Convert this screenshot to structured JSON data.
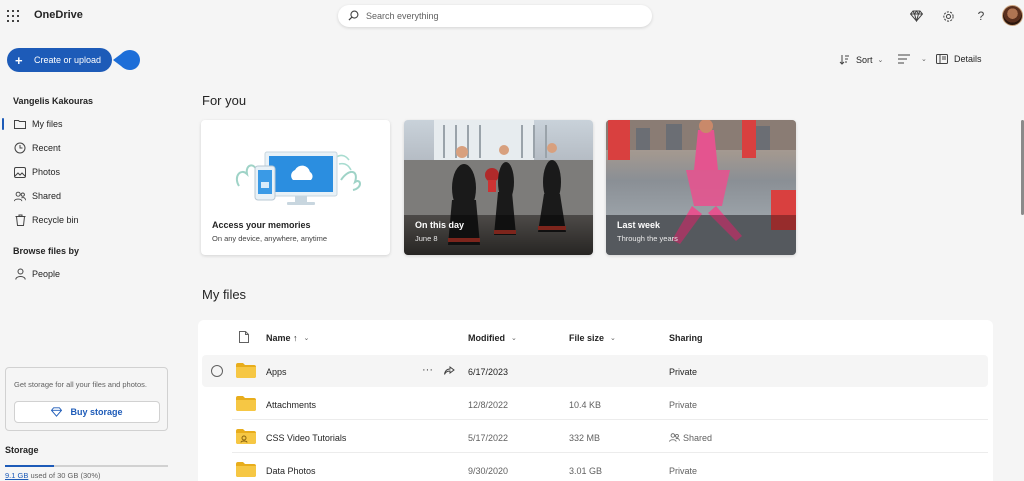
{
  "app": {
    "name": "OneDrive"
  },
  "search": {
    "placeholder": "Search everything"
  },
  "sidebar": {
    "create_label": "Create or upload",
    "user_name": "Vangelis Kakouras",
    "items": [
      {
        "label": "My files",
        "icon": "folder-icon",
        "active": true
      },
      {
        "label": "Recent",
        "icon": "clock-icon"
      },
      {
        "label": "Photos",
        "icon": "photo-icon"
      },
      {
        "label": "Shared",
        "icon": "people-icon"
      },
      {
        "label": "Recycle bin",
        "icon": "trash-icon"
      }
    ],
    "browse_title": "Browse files by",
    "browse_items": [
      {
        "label": "People",
        "icon": "person-icon"
      }
    ],
    "storage_promo": "Get storage for all your files and photos.",
    "buy_label": "Buy storage",
    "storage_title": "Storage",
    "storage_used_link": "9.1 GB",
    "storage_used_rest": " used of 30 GB (30%)",
    "storage_fraction": 0.3
  },
  "toolbar": {
    "sort_label": "Sort",
    "details_label": "Details"
  },
  "for_you": {
    "heading": "For you",
    "cards": [
      {
        "title": "Access your memories",
        "subtitle": "On any device, anywhere, anytime"
      },
      {
        "title": "On this day",
        "subtitle": "June 8"
      },
      {
        "title": "Last week",
        "subtitle": "Through the years"
      }
    ]
  },
  "my_files": {
    "heading": "My files",
    "columns": {
      "name": "Name ↑",
      "modified": "Modified",
      "size": "File size",
      "sharing": "Sharing"
    },
    "rows": [
      {
        "name": "Apps",
        "modified": "6/17/2023",
        "size": "",
        "sharing": "Private"
      },
      {
        "name": "Attachments",
        "modified": "12/8/2022",
        "size": "10.4 KB",
        "sharing": "Private"
      },
      {
        "name": "CSS Video Tutorials",
        "modified": "5/17/2022",
        "size": "332 MB",
        "sharing": "Shared"
      },
      {
        "name": "Data Photos",
        "modified": "9/30/2020",
        "size": "3.01 GB",
        "sharing": "Private"
      }
    ]
  },
  "colors": {
    "accent": "#1d5bb8",
    "folder": "#f4c542"
  }
}
